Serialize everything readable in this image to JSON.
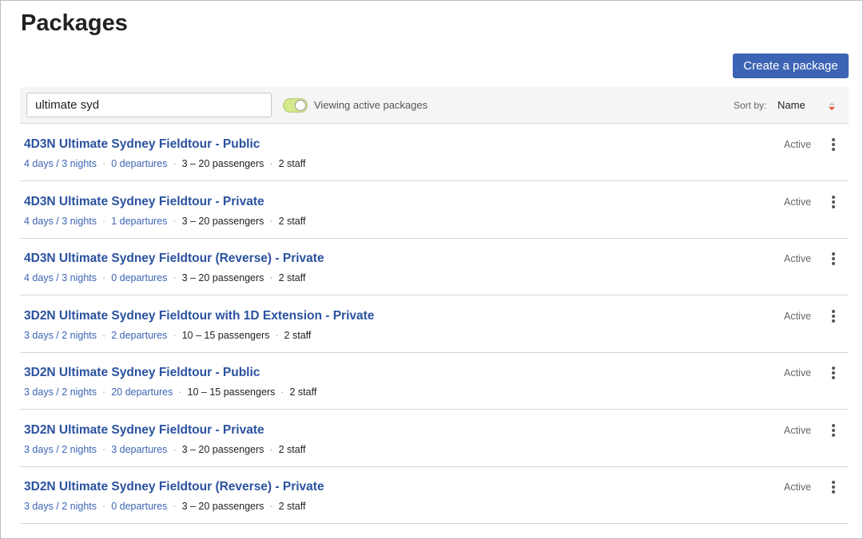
{
  "page": {
    "title": "Packages",
    "create_label": "Create a package"
  },
  "toolbar": {
    "search_value": "ultimate syd",
    "toggle_label": "Viewing active packages",
    "toggle_on": true,
    "sort_label": "Sort by:",
    "sort_value": "Name"
  },
  "colors": {
    "accent": "#3d64b4",
    "toggle": "#d3e98a",
    "sort_arrow": "#e8502a"
  },
  "packages": [
    {
      "title": "4D3N Ultimate Sydney Fieldtour - Public",
      "duration": "4 days / 3 nights",
      "departures": "0 departures",
      "passengers": "3 – 20 passengers",
      "staff": "2 staff",
      "status": "Active"
    },
    {
      "title": "4D3N Ultimate Sydney Fieldtour - Private",
      "duration": "4 days / 3 nights",
      "departures": "1 departures",
      "passengers": "3 – 20 passengers",
      "staff": "2 staff",
      "status": "Active"
    },
    {
      "title": "4D3N Ultimate Sydney Fieldtour (Reverse) - Private",
      "duration": "4 days / 3 nights",
      "departures": "0 departures",
      "passengers": "3 – 20 passengers",
      "staff": "2 staff",
      "status": "Active"
    },
    {
      "title": "3D2N Ultimate Sydney Fieldtour with 1D Extension - Private",
      "duration": "3 days / 2 nights",
      "departures": "2 departures",
      "passengers": "10 – 15 passengers",
      "staff": "2 staff",
      "status": "Active"
    },
    {
      "title": "3D2N Ultimate Sydney Fieldtour - Public",
      "duration": "3 days / 2 nights",
      "departures": "20 departures",
      "passengers": "10 – 15 passengers",
      "staff": "2 staff",
      "status": "Active"
    },
    {
      "title": "3D2N Ultimate Sydney Fieldtour - Private",
      "duration": "3 days / 2 nights",
      "departures": "3 departures",
      "passengers": "3 – 20 passengers",
      "staff": "2 staff",
      "status": "Active"
    },
    {
      "title": "3D2N Ultimate Sydney Fieldtour (Reverse) - Private",
      "duration": "3 days / 2 nights",
      "departures": "0 departures",
      "passengers": "3 – 20 passengers",
      "staff": "2 staff",
      "status": "Active"
    }
  ]
}
